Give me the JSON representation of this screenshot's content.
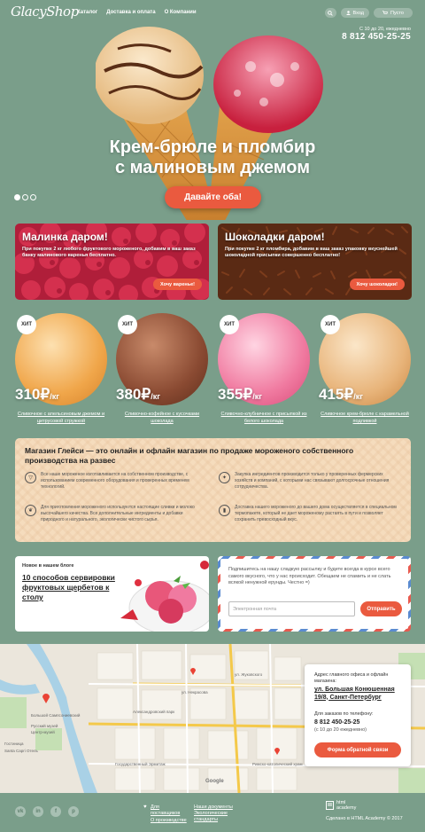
{
  "header": {
    "logo": "GlacyShop",
    "nav": [
      "Каталог",
      "Доставка и оплата",
      "О Компании"
    ],
    "login_label": "Вход",
    "cart_label": "Пусто",
    "hours": "С 10 до 20, ежедневно",
    "phone": "8 812 450-25-25"
  },
  "hero": {
    "title_line1": "Крем-брюле и пломбир",
    "title_line2": "с малиновым джемом",
    "cta": "Давайте оба!"
  },
  "promos": [
    {
      "title": "Малинка даром!",
      "text": "При покупке 2 кг любого фруктового мороженого, добавим в ваш заказ банку малинового варенья бесплатно.",
      "button": "Хочу варенье!",
      "bg": "#b01e3a"
    },
    {
      "title": "Шоколадки даром!",
      "text": "При покупке 2 кг пломбира, добавим в ваш заказ упаковку вкуснейшей шоколадной присыпки совершенно бесплатно!",
      "button": "Хочу шоколадки!",
      "bg": "#5a2a14"
    }
  ],
  "products": [
    {
      "badge": "ХИТ",
      "price": "310₽",
      "unit": "/кг",
      "name": "Сливочное с апельсиновым джемом и цитрусовой стружкой",
      "color": "#f0a64a"
    },
    {
      "badge": "ХИТ",
      "price": "380₽",
      "unit": "/кг",
      "name": "Сливочно-кофейное с кусочками шоколада",
      "color": "#8a4a32"
    },
    {
      "badge": "ХИТ",
      "price": "355₽",
      "unit": "/кг",
      "name": "Сливочно-клубничное с присыпкой из белого шоколада",
      "color": "#f07aa0"
    },
    {
      "badge": "ХИТ",
      "price": "415₽",
      "unit": "/кг",
      "name": "Сливочное крем-брюле с карамельной подливкой",
      "color": "#e8b47a"
    }
  ],
  "about": {
    "title": "Магазин Глейси — это онлайн и офлайн магазин по продаже мороженого собственного производства на развес",
    "features": [
      "Все наше мороженое изготавливается на собственном производстве, с использованием современного оборудования и проверенных временем технологий.",
      "Закупка ингредиентов производится только у проверенных фермерских хозяйств и компаний, с которыми нас связывают долгосрочные отношения сотрудничества.",
      "Для приготовления мороженого используются настоящие сливки и молоко высочайшего качества. Все дополнительные ингредиенты и добавки природного и натурального, экологически чистого сырья.",
      "Доставка нашего мороженого до вашего дома осуществляется в специальном термопакете, который не дает мороженому растаять в пути и позволяет сохранить превосходный вкус."
    ]
  },
  "blog": {
    "label": "Новое в нашем блоге",
    "title": "10 способов сервировки фруктовых щербетов к столу"
  },
  "subscribe": {
    "text": "Подпишитесь на нашу сладкую рассылку и будете всегда в курсе всего самого вкусного, что у нас происходит. Обещаем не спамить и не слать всякой ненужной ерунды. Честно =)",
    "placeholder": "Электронная почта",
    "button": "Отправить"
  },
  "map": {
    "address_label": "Адрес главного офиса и офлайн магазина:",
    "address": "ул. Большая Конюшенная 19/8, Санкт-Петербург",
    "phone_label": "Для заказов по телефону:",
    "phone": "8 812 450-25-25",
    "hours": "(с 10 до 20 ежедневно)",
    "button": "Форма обратной связи",
    "streets": [
      "ул. Некрасова",
      "ул. Жуковского",
      "Большой Сампсониевский",
      "Центр-музей",
      "Александровский парк",
      "Гостиница",
      "Santa Capri Отель",
      "Русский музей",
      "Государственный Эрмитаж",
      "Google",
      "Римско-католический храм"
    ]
  },
  "footer": {
    "social": [
      "vk",
      "in",
      "f",
      "p"
    ],
    "links": [
      "Для поставщиков",
      "О производстве",
      "Наши документы",
      "Экологические стандарты"
    ],
    "studio": "html academy",
    "credit": "Сделано в HTML Academy © 2017"
  }
}
